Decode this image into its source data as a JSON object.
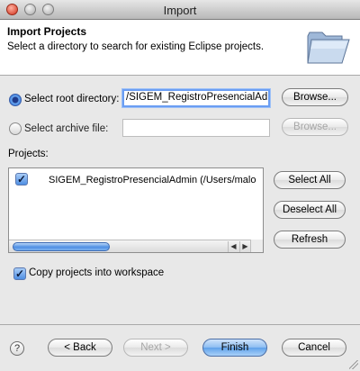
{
  "window": {
    "title": "Import"
  },
  "header": {
    "title": "Import Projects",
    "description": "Select a directory to search for existing Eclipse projects."
  },
  "root_dir": {
    "label": "Select root directory:",
    "value": "/SIGEM_RegistroPresencialAdmin",
    "browse": "Browse..."
  },
  "archive": {
    "label": "Select archive file:",
    "value": "",
    "browse": "Browse..."
  },
  "projects": {
    "label": "Projects:",
    "items": [
      {
        "label": "SIGEM_RegistroPresencialAdmin (/Users/malo",
        "checked": true
      }
    ],
    "select_all": "Select All",
    "deselect_all": "Deselect All",
    "refresh": "Refresh"
  },
  "copy": {
    "label": "Copy projects into workspace",
    "checked": true
  },
  "footer": {
    "help": "?",
    "back": "< Back",
    "next": "Next >",
    "finish": "Finish",
    "cancel": "Cancel"
  },
  "icons": {
    "folder": "open-folder-icon",
    "left_arrow": "◀",
    "right_arrow": "▶",
    "check": "✓"
  }
}
